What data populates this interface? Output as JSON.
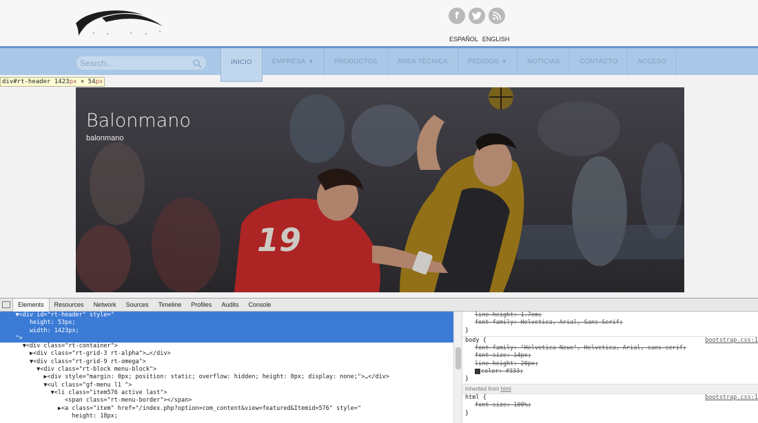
{
  "social": {
    "facebook_glyph": "f",
    "twitter_glyph": "t",
    "rss_glyph": "))"
  },
  "languages": [
    "ESPAÑOL",
    "ENGLISH"
  ],
  "search": {
    "placeholder": "Search..."
  },
  "menu": [
    {
      "label": "INICIO",
      "active": true,
      "dropdown": false
    },
    {
      "label": "EMPRESA",
      "active": false,
      "dropdown": true
    },
    {
      "label": "PRODUCTOS",
      "active": false,
      "dropdown": false
    },
    {
      "label": "ÁREA TÉCNICA",
      "active": false,
      "dropdown": false
    },
    {
      "label": "PEDIDOS",
      "active": false,
      "dropdown": true
    },
    {
      "label": "NOTICIAS",
      "active": false,
      "dropdown": false
    },
    {
      "label": "CONTACTO",
      "active": false,
      "dropdown": false
    },
    {
      "label": "ACCESO",
      "active": false,
      "dropdown": false
    }
  ],
  "inspector_tooltip": {
    "selector": "div#rt-header",
    "width": "1423",
    "height": "54",
    "unit": "px",
    "times": "×"
  },
  "hero": {
    "title": "Balonmano",
    "subtitle": "balonmano",
    "jersey_number": "19"
  },
  "devtools": {
    "tabs": [
      "Elements",
      "Resources",
      "Network",
      "Sources",
      "Timeline",
      "Profiles",
      "Audits",
      "Console"
    ],
    "active_tab": "Elements",
    "elements_lines": [
      "    ▼<div id=\"rt-header\" style=\"",
      "        height: 53px;",
      "        width: 1423px;",
      "    \">",
      "      ▼<div class=\"rt-container\">",
      "        ▶<div class=\"rt-grid-3 rt-alpha\">…</div>",
      "        ▼<div class=\"rt-grid-9 rt-omega\">",
      "          ▼<div class=\"rt-block menu-block\">",
      "            ▶<div style=\"margin: 0px; position: static; overflow: hidden; height: 0px; display: none;\">…</div>",
      "            ▼<ul class=\"gf-menu l1 \">",
      "              ▼<li class=\"item576 active last\">",
      "                  <span class=\"rt-menu-border\"></span>",
      "                ▶<a class=\"item\" href=\"/index.php?option=com_content&view=featured&Itemid=576\" style=\"",
      "                    height: 18px;"
    ],
    "selected_line_count": 4,
    "styles": {
      "top_lines": [
        "line-height: 1.7em;",
        "font-family: Helvetica, Arial, Sans-Serif;"
      ],
      "body_rule": {
        "selector": "body {",
        "source": "bootstrap.css:1",
        "props": [
          "font-family: \"Helvetica Neue\", Helvetica, Arial, sans-serif;",
          "font-size: 14px;",
          "line-height: 20px;",
          "color: #333;"
        ]
      },
      "inherited_label": "Inherited from",
      "inherited_tag": "html",
      "html_rule": {
        "selector": "html {",
        "source": "bootstrap.css:1",
        "props": [
          "font-size: 100%;"
        ]
      },
      "close_brace": "}"
    }
  }
}
